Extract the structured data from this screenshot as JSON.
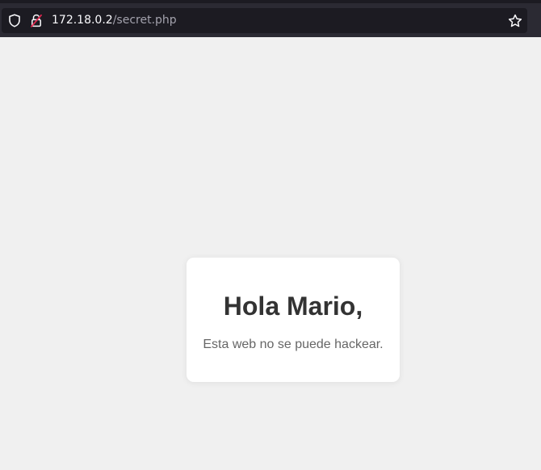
{
  "browser": {
    "url_host": "172.18.0.2",
    "url_path": "/secret.php",
    "icons": [
      "shield-icon",
      "insecure-lock-icon",
      "bookmark-star-icon"
    ],
    "colors": {
      "toolbar": "#2b2a33",
      "urlbar": "#1c1b22",
      "url_text": "#fbfbfe",
      "url_path_text": "#a3a2ad",
      "insecure_accent": "#e22850"
    }
  },
  "page": {
    "heading": "Hola Mario,",
    "message": "Esta web no se puede hackear.",
    "colors": {
      "background": "#f0f0f0",
      "card": "#ffffff",
      "heading": "#333333",
      "message": "#666666"
    }
  }
}
